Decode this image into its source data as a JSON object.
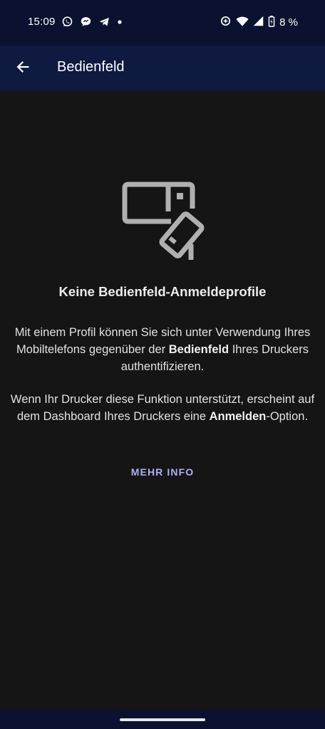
{
  "status_bar": {
    "time": "15:09",
    "battery_text": "8 %",
    "left_icons": [
      "whatsapp-icon",
      "chat-bubble-icon",
      "telegram-icon",
      "dot-icon"
    ],
    "right_icons": [
      "data-saver-icon",
      "wifi-icon",
      "signal-icon",
      "battery-icon"
    ]
  },
  "app_bar": {
    "back_icon": "arrow-back-icon",
    "title": "Bedienfeld"
  },
  "empty_state": {
    "icon": "panel-card-icon",
    "headline": "Keine Bedienfeld-Anmeldeprofile",
    "para1": {
      "part1": "Mit einem Profil können Sie sich unter Verwendung Ihres Mobiltelefons gegenüber der ",
      "bold": "Bedienfeld",
      "part2": " Ihres Druckers authentifizieren."
    },
    "para2": {
      "part1": "Wenn Ihr Drucker diese Funktion unterstützt, erscheint auf dem Dashboard Ihres Druckers eine ",
      "bold": "Anmelden",
      "part2": "-Option."
    },
    "more_info_label": "MEHR INFO"
  },
  "colors": {
    "status_bar_bg": "#0a1230",
    "app_bar_bg": "#0e1a3f",
    "content_bg": "#151515",
    "link": "#a7b3f4",
    "icon_gray": "#b0b0b0"
  }
}
